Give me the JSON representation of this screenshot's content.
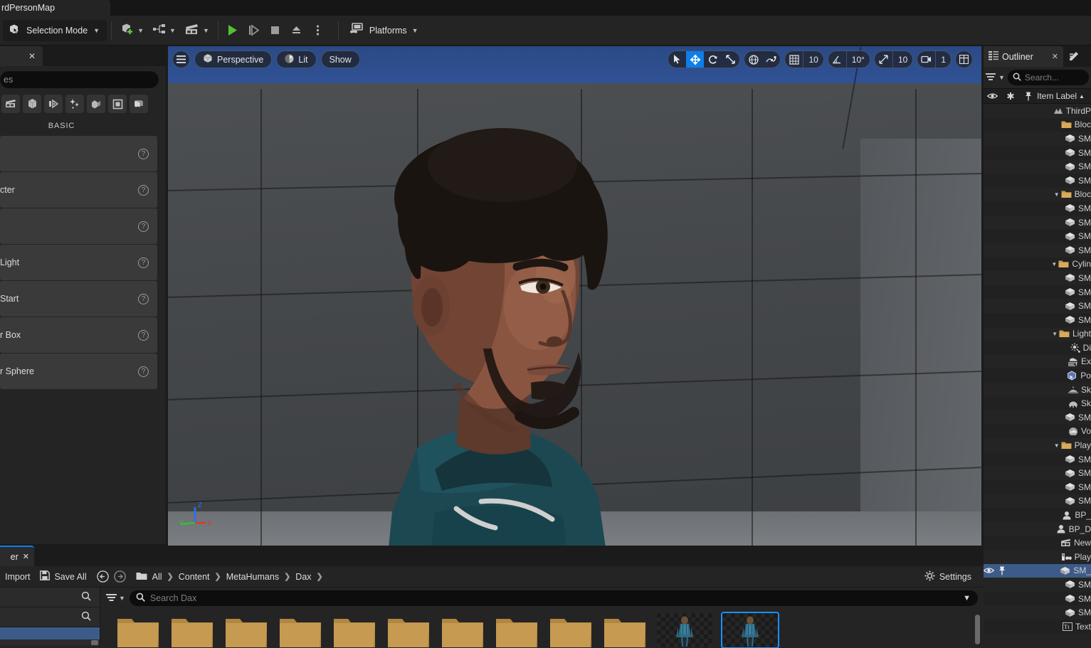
{
  "window": {
    "map_tab_label": "rdPersonMap"
  },
  "toolbar": {
    "selection_mode_label": "Selection Mode",
    "add_actor_icon": "add-actor-icon",
    "blueprints_icon": "blueprints-icon",
    "cinematics_icon": "cinematics-icon",
    "play_icon": "play-icon",
    "skip_icon": "skip-play-icon",
    "stop_icon": "stop-icon",
    "eject_icon": "eject-icon",
    "more_icon": "more-options-icon",
    "platforms_label": "Platforms"
  },
  "place_actors": {
    "tab_close_icon": "close-icon",
    "search_value": "es",
    "search_placeholder": "Search Classes",
    "categories": [
      {
        "name": "recently-placed-icon"
      },
      {
        "name": "basic-icon"
      },
      {
        "name": "lights-icon"
      },
      {
        "name": "cinematic-icon"
      },
      {
        "name": "visual-effects-icon"
      },
      {
        "name": "geometry-icon"
      },
      {
        "name": "volumes-icon"
      },
      {
        "name": "all-classes-icon"
      }
    ],
    "section_label": "BASIC",
    "items": [
      {
        "label": ""
      },
      {
        "label": "cter"
      },
      {
        "label": ""
      },
      {
        "label": "Light"
      },
      {
        "label": " Start"
      },
      {
        "label": "r Box"
      },
      {
        "label": "r Sphere"
      }
    ],
    "help_icon": "help-icon"
  },
  "viewport": {
    "menu_icon": "viewport-menu-icon",
    "perspective_label": "Perspective",
    "perspective_icon": "cube-icon",
    "lit_label": "Lit",
    "lit_icon": "sphere-shading-icon",
    "show_label": "Show",
    "tools": [
      {
        "name": "select-tool",
        "icon": "cursor-arrow-icon",
        "active": false
      },
      {
        "name": "move-tool",
        "icon": "move-arrows-icon",
        "active": true
      },
      {
        "name": "rotate-tool",
        "icon": "rotate-icon",
        "active": false
      },
      {
        "name": "scale-tool",
        "icon": "scale-icon",
        "active": false
      }
    ],
    "coord_system_icon": "globe-icon",
    "surface_snap_icon": "surface-snap-icon",
    "grid_snap_icon": "grid-snap-icon",
    "grid_snap_value": "10",
    "angle_snap_icon": "angle-snap-icon",
    "angle_snap_value": "10°",
    "scale_snap_icon": "scale-snap-icon",
    "scale_snap_value": "10",
    "camera_speed_icon": "camera-icon",
    "camera_speed_value": "1",
    "layout_icon": "viewport-layout-icon",
    "axis_x_label": "X",
    "axis_y_label": "Y",
    "axis_z_label": "Z"
  },
  "outliner": {
    "tab_label": "Outliner",
    "tab_icon": "outliner-icon",
    "tab_close_icon": "close-icon",
    "details_tab_icon": "details-pencil-icon",
    "filter_icon": "filter-icon",
    "search_placeholder": "Search...",
    "search_icon": "search-icon",
    "columns": {
      "visibility_icon": "eye-icon",
      "favorite_icon": "star-icon",
      "pin_icon": "pin-icon",
      "label": "Item Label",
      "sort_icon": "sort-ascending-icon"
    },
    "rows": [
      {
        "indent": 0,
        "icon": "level-icon",
        "label": "ThirdP",
        "type": "level"
      },
      {
        "indent": 1,
        "icon": "folder-icon",
        "label": "Bloc",
        "type": "folder"
      },
      {
        "indent": 2,
        "icon": "static-mesh-icon",
        "label": "SM",
        "type": "mesh"
      },
      {
        "indent": 2,
        "icon": "static-mesh-icon",
        "label": "SM",
        "type": "mesh"
      },
      {
        "indent": 2,
        "icon": "static-mesh-icon",
        "label": "SM",
        "type": "mesh"
      },
      {
        "indent": 2,
        "icon": "static-mesh-icon",
        "label": "SM",
        "type": "mesh"
      },
      {
        "indent": 1,
        "icon": "folder-icon",
        "label": "Bloc",
        "type": "folder",
        "expanded": true
      },
      {
        "indent": 2,
        "icon": "static-mesh-icon",
        "label": "SM",
        "type": "mesh"
      },
      {
        "indent": 2,
        "icon": "static-mesh-icon",
        "label": "SM",
        "type": "mesh"
      },
      {
        "indent": 2,
        "icon": "static-mesh-icon",
        "label": "SM",
        "type": "mesh"
      },
      {
        "indent": 2,
        "icon": "static-mesh-icon",
        "label": "SM",
        "type": "mesh"
      },
      {
        "indent": 1,
        "icon": "folder-icon",
        "label": "Cylin",
        "type": "folder",
        "expanded": true
      },
      {
        "indent": 2,
        "icon": "static-mesh-icon",
        "label": "SM",
        "type": "mesh"
      },
      {
        "indent": 2,
        "icon": "static-mesh-icon",
        "label": "SM",
        "type": "mesh"
      },
      {
        "indent": 2,
        "icon": "static-mesh-icon",
        "label": "SM",
        "type": "mesh"
      },
      {
        "indent": 2,
        "icon": "static-mesh-icon",
        "label": "SM",
        "type": "mesh"
      },
      {
        "indent": 1,
        "icon": "folder-icon",
        "label": "Light",
        "type": "folder",
        "expanded": true
      },
      {
        "indent": 2,
        "icon": "directional-light-icon",
        "label": "Di",
        "type": "light"
      },
      {
        "indent": 2,
        "icon": "height-fog-icon",
        "label": "Ex",
        "type": "fog"
      },
      {
        "indent": 2,
        "icon": "post-process-volume-icon",
        "label": "Po",
        "type": "volume"
      },
      {
        "indent": 2,
        "icon": "sky-atmosphere-icon",
        "label": "Sk",
        "type": "sky"
      },
      {
        "indent": 2,
        "icon": "sky-light-icon",
        "label": "Sk",
        "type": "light"
      },
      {
        "indent": 2,
        "icon": "static-mesh-icon",
        "label": "SM",
        "type": "mesh"
      },
      {
        "indent": 2,
        "icon": "volumetric-cloud-icon",
        "label": "Vo",
        "type": "cloud"
      },
      {
        "indent": 1,
        "icon": "folder-icon",
        "label": "Play",
        "type": "folder",
        "expanded": true
      },
      {
        "indent": 2,
        "icon": "static-mesh-icon",
        "label": "SM",
        "type": "mesh"
      },
      {
        "indent": 2,
        "icon": "static-mesh-icon",
        "label": "SM",
        "type": "mesh"
      },
      {
        "indent": 2,
        "icon": "static-mesh-icon",
        "label": "SM",
        "type": "mesh"
      },
      {
        "indent": 2,
        "icon": "static-mesh-icon",
        "label": "SM",
        "type": "mesh"
      },
      {
        "indent": 2,
        "icon": "blueprint-icon",
        "label": "BP_",
        "type": "blueprint"
      },
      {
        "indent": 2,
        "icon": "blueprint-icon",
        "label": "BP_D",
        "type": "blueprint"
      },
      {
        "indent": 2,
        "icon": "cinematic-icon",
        "label": "New",
        "type": "sequence"
      },
      {
        "indent": 2,
        "icon": "player-start-icon",
        "label": "Play",
        "type": "player-start"
      },
      {
        "indent": 2,
        "icon": "static-mesh-icon",
        "label": "SM_",
        "type": "mesh",
        "selected": true
      },
      {
        "indent": 2,
        "icon": "static-mesh-icon",
        "label": "SM",
        "type": "mesh"
      },
      {
        "indent": 2,
        "icon": "static-mesh-icon",
        "label": "SM",
        "type": "mesh"
      },
      {
        "indent": 2,
        "icon": "static-mesh-icon",
        "label": "SM",
        "type": "mesh"
      },
      {
        "indent": 2,
        "icon": "text-render-icon",
        "label": "Text",
        "type": "text"
      }
    ]
  },
  "content_browser": {
    "tab_label": "er",
    "tab_close_icon": "close-icon",
    "import_label": "Import",
    "import_icon": "import-icon",
    "save_all_label": "Save All",
    "save_all_icon": "save-icon",
    "nav_back_icon": "back-arrow-icon",
    "nav_forward_icon": "forward-arrow-icon",
    "path_root_icon": "folder-icon",
    "breadcrumbs": [
      "All",
      "Content",
      "MetaHumans",
      "Dax"
    ],
    "settings_label": "Settings",
    "settings_icon": "gear-icon",
    "sources_search_icon": "search-icon",
    "filter_icon": "filter-icon",
    "search_placeholder": "Search Dax",
    "search_dropdown_icon": "chevron-down-icon",
    "folder_tiles": 10,
    "asset_tiles": [
      {
        "name": "metahuman-thumbnail",
        "selected": false
      },
      {
        "name": "metahuman-thumbnail",
        "selected": true
      }
    ]
  },
  "colors": {
    "accent_blue": "#0c7fe8",
    "selection_blue": "#3c5b88",
    "panel_bg": "#242424",
    "folder_gold": "#c79a4e",
    "play_green": "#52c234"
  }
}
